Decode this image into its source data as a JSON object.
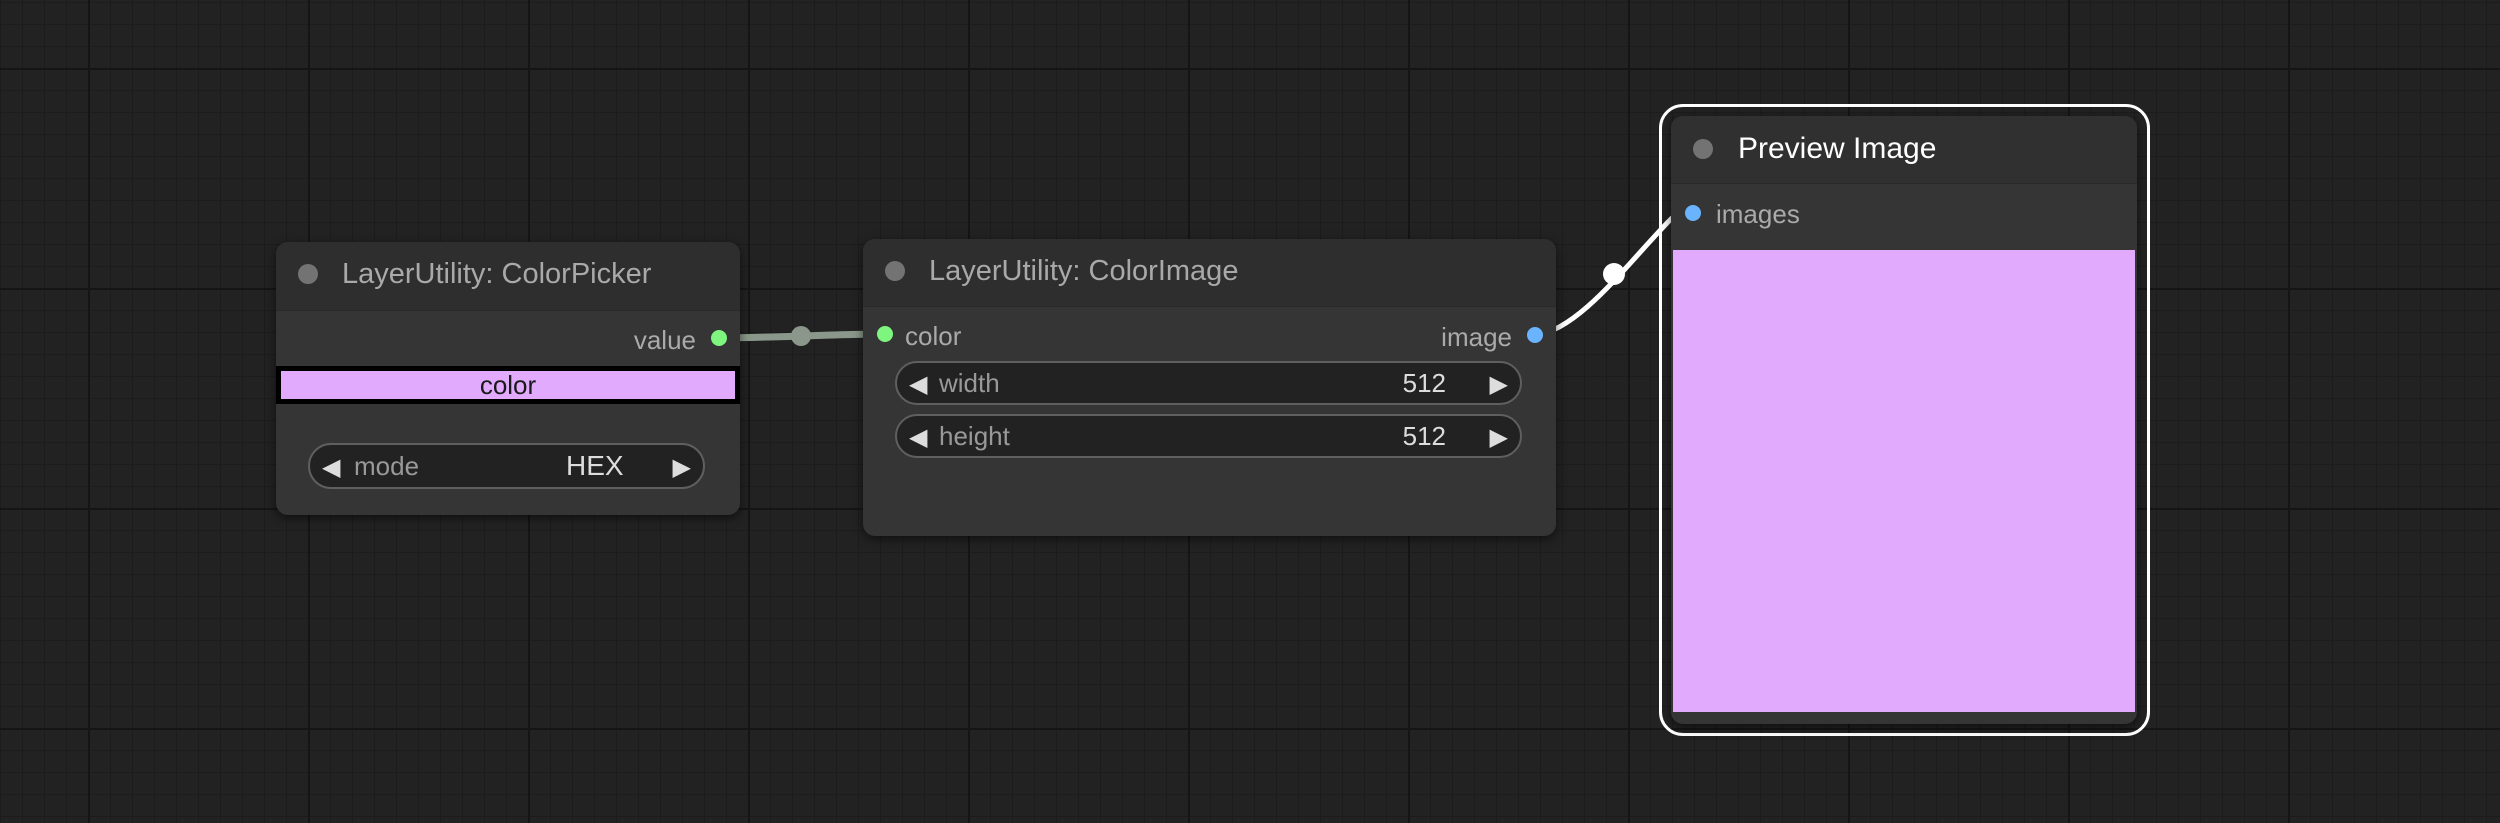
{
  "nodes": {
    "color_picker": {
      "title": "LayerUtility: ColorPicker",
      "output_label": "value",
      "color_swatch_label": "color",
      "mode_label": "mode",
      "mode_value": "HEX",
      "swatch_color": "#e1aafd"
    },
    "color_image": {
      "title": "LayerUtility: ColorImage",
      "input_label": "color",
      "output_label": "image",
      "width_label": "width",
      "width_value": "512",
      "height_label": "height",
      "height_value": "512"
    },
    "preview_image": {
      "title": "Preview Image",
      "input_label": "images",
      "preview_color": "#e1aafd"
    }
  },
  "colors": {
    "canvas": "#222222",
    "node_body": "#353535",
    "slot_green": "#7ef57e",
    "slot_blue": "#6ab4ff",
    "link_gray": "#8a978a"
  },
  "icons": {
    "decrement": "◀",
    "increment": "▶"
  }
}
